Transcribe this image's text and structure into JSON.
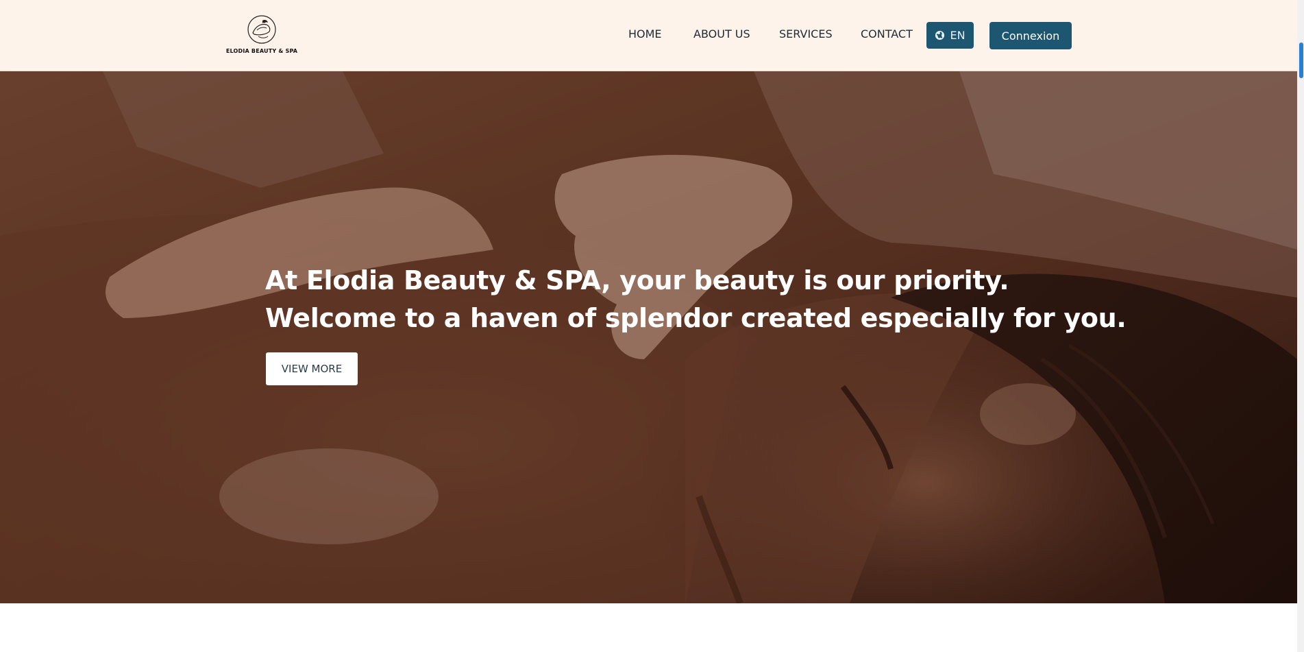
{
  "brand": {
    "logo_text": "ELODIA BEAUTY & SPA",
    "accent_color": "#1c5670",
    "header_bg": "#fdf3ea"
  },
  "nav": {
    "items": [
      {
        "label": "HOME"
      },
      {
        "label": "ABOUT US"
      },
      {
        "label": "SERVICES"
      },
      {
        "label": "CONTACT"
      }
    ],
    "language": {
      "label": "EN",
      "icon": "globe-icon"
    },
    "login_label": "Connexion"
  },
  "hero": {
    "line1": "At Elodia Beauty & SPA, your beauty is our priority.",
    "line2": "Welcome to a haven of splendor created especially for you.",
    "cta_label": "VIEW MORE"
  }
}
